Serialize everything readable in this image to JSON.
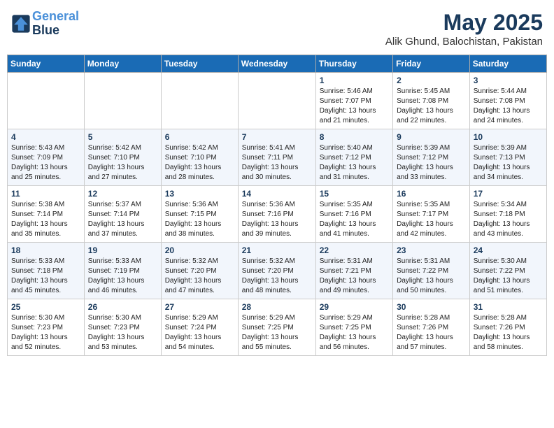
{
  "logo": {
    "line1": "General",
    "line2": "Blue"
  },
  "title": "May 2025",
  "location": "Alik Ghund, Balochistan, Pakistan",
  "weekdays": [
    "Sunday",
    "Monday",
    "Tuesday",
    "Wednesday",
    "Thursday",
    "Friday",
    "Saturday"
  ],
  "weeks": [
    [
      {
        "day": "",
        "info": ""
      },
      {
        "day": "",
        "info": ""
      },
      {
        "day": "",
        "info": ""
      },
      {
        "day": "",
        "info": ""
      },
      {
        "day": "1",
        "info": "Sunrise: 5:46 AM\nSunset: 7:07 PM\nDaylight: 13 hours\nand 21 minutes."
      },
      {
        "day": "2",
        "info": "Sunrise: 5:45 AM\nSunset: 7:08 PM\nDaylight: 13 hours\nand 22 minutes."
      },
      {
        "day": "3",
        "info": "Sunrise: 5:44 AM\nSunset: 7:08 PM\nDaylight: 13 hours\nand 24 minutes."
      }
    ],
    [
      {
        "day": "4",
        "info": "Sunrise: 5:43 AM\nSunset: 7:09 PM\nDaylight: 13 hours\nand 25 minutes."
      },
      {
        "day": "5",
        "info": "Sunrise: 5:42 AM\nSunset: 7:10 PM\nDaylight: 13 hours\nand 27 minutes."
      },
      {
        "day": "6",
        "info": "Sunrise: 5:42 AM\nSunset: 7:10 PM\nDaylight: 13 hours\nand 28 minutes."
      },
      {
        "day": "7",
        "info": "Sunrise: 5:41 AM\nSunset: 7:11 PM\nDaylight: 13 hours\nand 30 minutes."
      },
      {
        "day": "8",
        "info": "Sunrise: 5:40 AM\nSunset: 7:12 PM\nDaylight: 13 hours\nand 31 minutes."
      },
      {
        "day": "9",
        "info": "Sunrise: 5:39 AM\nSunset: 7:12 PM\nDaylight: 13 hours\nand 33 minutes."
      },
      {
        "day": "10",
        "info": "Sunrise: 5:39 AM\nSunset: 7:13 PM\nDaylight: 13 hours\nand 34 minutes."
      }
    ],
    [
      {
        "day": "11",
        "info": "Sunrise: 5:38 AM\nSunset: 7:14 PM\nDaylight: 13 hours\nand 35 minutes."
      },
      {
        "day": "12",
        "info": "Sunrise: 5:37 AM\nSunset: 7:14 PM\nDaylight: 13 hours\nand 37 minutes."
      },
      {
        "day": "13",
        "info": "Sunrise: 5:36 AM\nSunset: 7:15 PM\nDaylight: 13 hours\nand 38 minutes."
      },
      {
        "day": "14",
        "info": "Sunrise: 5:36 AM\nSunset: 7:16 PM\nDaylight: 13 hours\nand 39 minutes."
      },
      {
        "day": "15",
        "info": "Sunrise: 5:35 AM\nSunset: 7:16 PM\nDaylight: 13 hours\nand 41 minutes."
      },
      {
        "day": "16",
        "info": "Sunrise: 5:35 AM\nSunset: 7:17 PM\nDaylight: 13 hours\nand 42 minutes."
      },
      {
        "day": "17",
        "info": "Sunrise: 5:34 AM\nSunset: 7:18 PM\nDaylight: 13 hours\nand 43 minutes."
      }
    ],
    [
      {
        "day": "18",
        "info": "Sunrise: 5:33 AM\nSunset: 7:18 PM\nDaylight: 13 hours\nand 45 minutes."
      },
      {
        "day": "19",
        "info": "Sunrise: 5:33 AM\nSunset: 7:19 PM\nDaylight: 13 hours\nand 46 minutes."
      },
      {
        "day": "20",
        "info": "Sunrise: 5:32 AM\nSunset: 7:20 PM\nDaylight: 13 hours\nand 47 minutes."
      },
      {
        "day": "21",
        "info": "Sunrise: 5:32 AM\nSunset: 7:20 PM\nDaylight: 13 hours\nand 48 minutes."
      },
      {
        "day": "22",
        "info": "Sunrise: 5:31 AM\nSunset: 7:21 PM\nDaylight: 13 hours\nand 49 minutes."
      },
      {
        "day": "23",
        "info": "Sunrise: 5:31 AM\nSunset: 7:22 PM\nDaylight: 13 hours\nand 50 minutes."
      },
      {
        "day": "24",
        "info": "Sunrise: 5:30 AM\nSunset: 7:22 PM\nDaylight: 13 hours\nand 51 minutes."
      }
    ],
    [
      {
        "day": "25",
        "info": "Sunrise: 5:30 AM\nSunset: 7:23 PM\nDaylight: 13 hours\nand 52 minutes."
      },
      {
        "day": "26",
        "info": "Sunrise: 5:30 AM\nSunset: 7:23 PM\nDaylight: 13 hours\nand 53 minutes."
      },
      {
        "day": "27",
        "info": "Sunrise: 5:29 AM\nSunset: 7:24 PM\nDaylight: 13 hours\nand 54 minutes."
      },
      {
        "day": "28",
        "info": "Sunrise: 5:29 AM\nSunset: 7:25 PM\nDaylight: 13 hours\nand 55 minutes."
      },
      {
        "day": "29",
        "info": "Sunrise: 5:29 AM\nSunset: 7:25 PM\nDaylight: 13 hours\nand 56 minutes."
      },
      {
        "day": "30",
        "info": "Sunrise: 5:28 AM\nSunset: 7:26 PM\nDaylight: 13 hours\nand 57 minutes."
      },
      {
        "day": "31",
        "info": "Sunrise: 5:28 AM\nSunset: 7:26 PM\nDaylight: 13 hours\nand 58 minutes."
      }
    ]
  ]
}
